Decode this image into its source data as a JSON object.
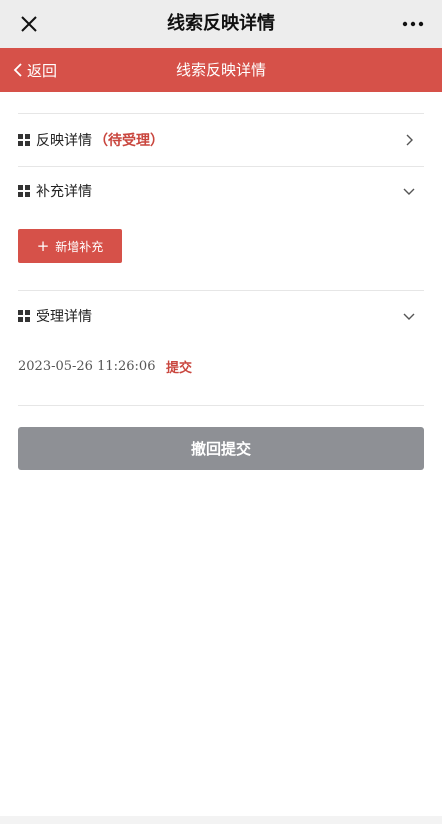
{
  "wechat_bar": {
    "title": "线索反映详情",
    "close_icon": "close-icon",
    "more_icon": "more-dots-icon"
  },
  "header": {
    "back_label": "返回",
    "title": "线索反映详情",
    "color": "#d65149"
  },
  "sections": {
    "report": {
      "label": "反映详情",
      "status": "（待受理）",
      "icon": "grid-icon",
      "arrow": "chevron-right-icon"
    },
    "supplement": {
      "label": "补充详情",
      "icon": "grid-icon",
      "arrow": "chevron-down-icon"
    },
    "acceptance": {
      "label": "受理详情",
      "icon": "grid-icon",
      "arrow": "chevron-down-icon"
    }
  },
  "add_button": {
    "plus": "+",
    "label": "新增补充"
  },
  "record": {
    "time": "2023-05-26 11:26:06",
    "action": "提交"
  },
  "withdraw_button": {
    "label": "撤回提交",
    "color": "#8e9095"
  },
  "colors": {
    "accent": "#d65149",
    "status_text": "#c9463e"
  }
}
